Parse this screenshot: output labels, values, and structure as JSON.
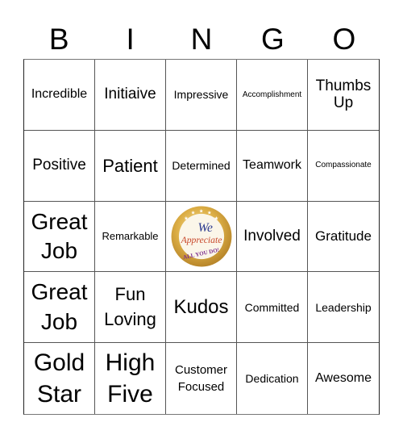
{
  "header": {
    "letters": [
      "B",
      "I",
      "N",
      "G",
      "O"
    ]
  },
  "cells": [
    [
      "Incredible",
      "Initiaive",
      "Impressive",
      "Accomplishment",
      "Thumbs Up"
    ],
    [
      "Positive",
      "Patient",
      "Determined",
      "Teamwork",
      "Compassionate"
    ],
    [
      "Great Job",
      "Remarkable",
      "We Appreciate All You Do!",
      "Involved",
      "Gratitude"
    ],
    [
      "Great Job",
      "Fun Loving",
      "Kudos",
      "Committed",
      "Leadership"
    ],
    [
      "Gold Star",
      "High Five",
      "Customer Focused",
      "Dedication",
      "Awesome"
    ]
  ],
  "free_space": {
    "line1": "We",
    "line2": "Appreciate",
    "line3": "ALL YOU DO!",
    "colors": {
      "gold": "#d9a93a",
      "gold_light": "#f3dc8c",
      "we": "#2b3a8f",
      "appreciate": "#c8472a",
      "all_you_do": "#7a2a8c"
    }
  }
}
